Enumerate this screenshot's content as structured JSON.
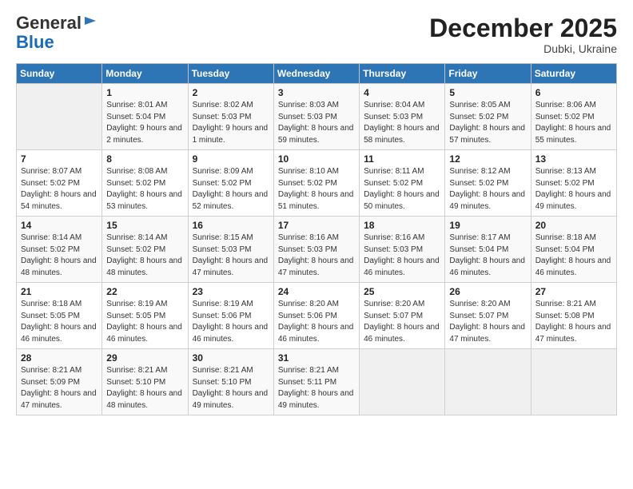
{
  "logo": {
    "general": "General",
    "blue": "Blue"
  },
  "header": {
    "month": "December 2025",
    "location": "Dubki, Ukraine"
  },
  "days_of_week": [
    "Sunday",
    "Monday",
    "Tuesday",
    "Wednesday",
    "Thursday",
    "Friday",
    "Saturday"
  ],
  "weeks": [
    [
      {
        "day": "",
        "sunrise": "",
        "sunset": "",
        "daylight": "",
        "empty": true
      },
      {
        "day": "1",
        "sunrise": "Sunrise: 8:01 AM",
        "sunset": "Sunset: 5:04 PM",
        "daylight": "Daylight: 9 hours and 2 minutes."
      },
      {
        "day": "2",
        "sunrise": "Sunrise: 8:02 AM",
        "sunset": "Sunset: 5:03 PM",
        "daylight": "Daylight: 9 hours and 1 minute."
      },
      {
        "day": "3",
        "sunrise": "Sunrise: 8:03 AM",
        "sunset": "Sunset: 5:03 PM",
        "daylight": "Daylight: 8 hours and 59 minutes."
      },
      {
        "day": "4",
        "sunrise": "Sunrise: 8:04 AM",
        "sunset": "Sunset: 5:03 PM",
        "daylight": "Daylight: 8 hours and 58 minutes."
      },
      {
        "day": "5",
        "sunrise": "Sunrise: 8:05 AM",
        "sunset": "Sunset: 5:02 PM",
        "daylight": "Daylight: 8 hours and 57 minutes."
      },
      {
        "day": "6",
        "sunrise": "Sunrise: 8:06 AM",
        "sunset": "Sunset: 5:02 PM",
        "daylight": "Daylight: 8 hours and 55 minutes."
      }
    ],
    [
      {
        "day": "7",
        "sunrise": "Sunrise: 8:07 AM",
        "sunset": "Sunset: 5:02 PM",
        "daylight": "Daylight: 8 hours and 54 minutes."
      },
      {
        "day": "8",
        "sunrise": "Sunrise: 8:08 AM",
        "sunset": "Sunset: 5:02 PM",
        "daylight": "Daylight: 8 hours and 53 minutes."
      },
      {
        "day": "9",
        "sunrise": "Sunrise: 8:09 AM",
        "sunset": "Sunset: 5:02 PM",
        "daylight": "Daylight: 8 hours and 52 minutes."
      },
      {
        "day": "10",
        "sunrise": "Sunrise: 8:10 AM",
        "sunset": "Sunset: 5:02 PM",
        "daylight": "Daylight: 8 hours and 51 minutes."
      },
      {
        "day": "11",
        "sunrise": "Sunrise: 8:11 AM",
        "sunset": "Sunset: 5:02 PM",
        "daylight": "Daylight: 8 hours and 50 minutes."
      },
      {
        "day": "12",
        "sunrise": "Sunrise: 8:12 AM",
        "sunset": "Sunset: 5:02 PM",
        "daylight": "Daylight: 8 hours and 49 minutes."
      },
      {
        "day": "13",
        "sunrise": "Sunrise: 8:13 AM",
        "sunset": "Sunset: 5:02 PM",
        "daylight": "Daylight: 8 hours and 49 minutes."
      }
    ],
    [
      {
        "day": "14",
        "sunrise": "Sunrise: 8:14 AM",
        "sunset": "Sunset: 5:02 PM",
        "daylight": "Daylight: 8 hours and 48 minutes."
      },
      {
        "day": "15",
        "sunrise": "Sunrise: 8:14 AM",
        "sunset": "Sunset: 5:02 PM",
        "daylight": "Daylight: 8 hours and 48 minutes."
      },
      {
        "day": "16",
        "sunrise": "Sunrise: 8:15 AM",
        "sunset": "Sunset: 5:03 PM",
        "daylight": "Daylight: 8 hours and 47 minutes."
      },
      {
        "day": "17",
        "sunrise": "Sunrise: 8:16 AM",
        "sunset": "Sunset: 5:03 PM",
        "daylight": "Daylight: 8 hours and 47 minutes."
      },
      {
        "day": "18",
        "sunrise": "Sunrise: 8:16 AM",
        "sunset": "Sunset: 5:03 PM",
        "daylight": "Daylight: 8 hours and 46 minutes."
      },
      {
        "day": "19",
        "sunrise": "Sunrise: 8:17 AM",
        "sunset": "Sunset: 5:04 PM",
        "daylight": "Daylight: 8 hours and 46 minutes."
      },
      {
        "day": "20",
        "sunrise": "Sunrise: 8:18 AM",
        "sunset": "Sunset: 5:04 PM",
        "daylight": "Daylight: 8 hours and 46 minutes."
      }
    ],
    [
      {
        "day": "21",
        "sunrise": "Sunrise: 8:18 AM",
        "sunset": "Sunset: 5:05 PM",
        "daylight": "Daylight: 8 hours and 46 minutes."
      },
      {
        "day": "22",
        "sunrise": "Sunrise: 8:19 AM",
        "sunset": "Sunset: 5:05 PM",
        "daylight": "Daylight: 8 hours and 46 minutes."
      },
      {
        "day": "23",
        "sunrise": "Sunrise: 8:19 AM",
        "sunset": "Sunset: 5:06 PM",
        "daylight": "Daylight: 8 hours and 46 minutes."
      },
      {
        "day": "24",
        "sunrise": "Sunrise: 8:20 AM",
        "sunset": "Sunset: 5:06 PM",
        "daylight": "Daylight: 8 hours and 46 minutes."
      },
      {
        "day": "25",
        "sunrise": "Sunrise: 8:20 AM",
        "sunset": "Sunset: 5:07 PM",
        "daylight": "Daylight: 8 hours and 46 minutes."
      },
      {
        "day": "26",
        "sunrise": "Sunrise: 8:20 AM",
        "sunset": "Sunset: 5:07 PM",
        "daylight": "Daylight: 8 hours and 47 minutes."
      },
      {
        "day": "27",
        "sunrise": "Sunrise: 8:21 AM",
        "sunset": "Sunset: 5:08 PM",
        "daylight": "Daylight: 8 hours and 47 minutes."
      }
    ],
    [
      {
        "day": "28",
        "sunrise": "Sunrise: 8:21 AM",
        "sunset": "Sunset: 5:09 PM",
        "daylight": "Daylight: 8 hours and 47 minutes."
      },
      {
        "day": "29",
        "sunrise": "Sunrise: 8:21 AM",
        "sunset": "Sunset: 5:10 PM",
        "daylight": "Daylight: 8 hours and 48 minutes."
      },
      {
        "day": "30",
        "sunrise": "Sunrise: 8:21 AM",
        "sunset": "Sunset: 5:10 PM",
        "daylight": "Daylight: 8 hours and 49 minutes."
      },
      {
        "day": "31",
        "sunrise": "Sunrise: 8:21 AM",
        "sunset": "Sunset: 5:11 PM",
        "daylight": "Daylight: 8 hours and 49 minutes."
      },
      {
        "day": "",
        "sunrise": "",
        "sunset": "",
        "daylight": "",
        "empty": true
      },
      {
        "day": "",
        "sunrise": "",
        "sunset": "",
        "daylight": "",
        "empty": true
      },
      {
        "day": "",
        "sunrise": "",
        "sunset": "",
        "daylight": "",
        "empty": true
      }
    ]
  ]
}
